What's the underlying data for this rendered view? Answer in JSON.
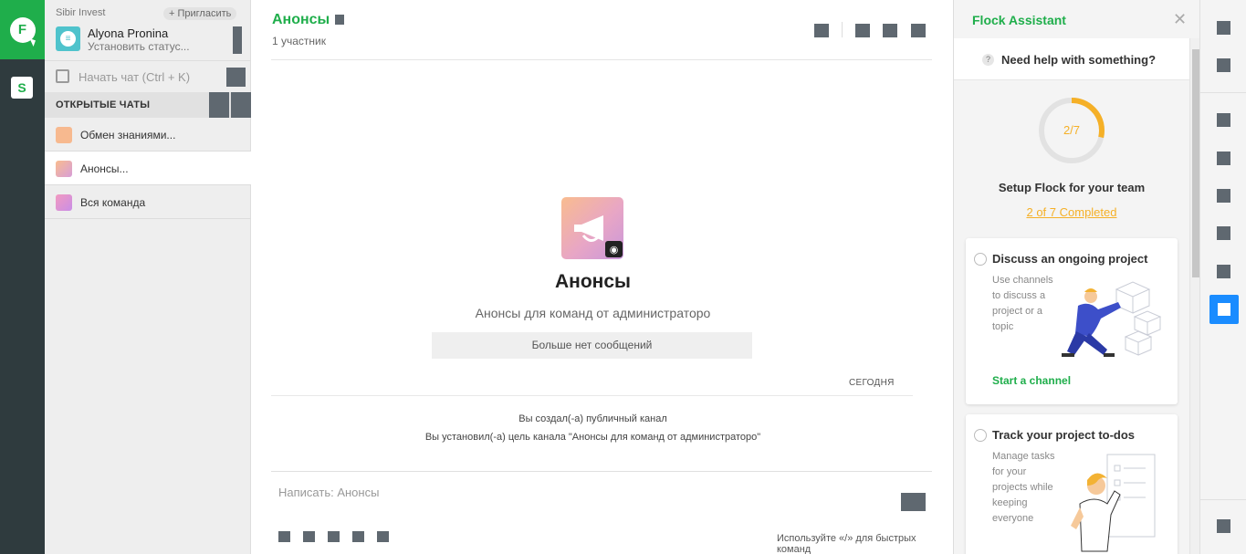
{
  "rail": {
    "logo_letter": "F",
    "team_letter": "S",
    "accent": "#1fae4b"
  },
  "sidebar": {
    "workspace": "Sibir Invest",
    "invite_label": "+ Пригласить",
    "user_name": "Alyona Pronina",
    "user_status": "Установить статус...",
    "start_chat_label": "Начать чат (Ctrl + K)",
    "open_chats_header": "ОТКРЫТЫЕ ЧАТЫ",
    "chats": [
      {
        "name": "Обмен знаниями...",
        "icon": "people-icon",
        "color": "#f7b98f"
      },
      {
        "name": "Анонсы...",
        "icon": "megaphone-icon",
        "color": "#eaa3b8"
      },
      {
        "name": "Вся команда",
        "icon": "chat-bubbles-icon",
        "color": "#e38ad2"
      }
    ]
  },
  "main": {
    "channel_title": "Анонсы",
    "members": "1 участник",
    "channel_name_big": "Анонсы",
    "channel_description": "Анонсы для команд от администраторо",
    "no_more_messages": "Больше нет сообщений",
    "today_label": "СЕГОДНЯ",
    "system_messages": [
      "Вы создал(-а) публичный канал",
      "Вы установил(-а) цель канала \"Анонсы для команд от администраторо\""
    ],
    "composer_placeholder": "Написать: Анонсы",
    "composer_hint": "Используйте «/» для быстрых команд"
  },
  "assistant": {
    "title": "Flock Assistant",
    "close_glyph": "✕",
    "help_text": "Need help with something?",
    "help_glyph": "?",
    "progress_done": 2,
    "progress_total": 7,
    "progress_label": "2/7",
    "setup_title": "Setup Flock for your team",
    "setup_progress": "2 of 7 Completed",
    "progress_color": "#f5b027",
    "cards": [
      {
        "title": "Discuss an ongoing project",
        "desc": "Use channels to discuss a project or a topic",
        "link": "Start a channel",
        "illustration": "person-building-blocks-illustration"
      },
      {
        "title": "Track your project to-dos",
        "desc": "Manage tasks for your projects while keeping everyone",
        "link": "",
        "illustration": "person-with-checklist-illustration"
      }
    ]
  },
  "appbar": {
    "active_color": "#1a8cff"
  }
}
